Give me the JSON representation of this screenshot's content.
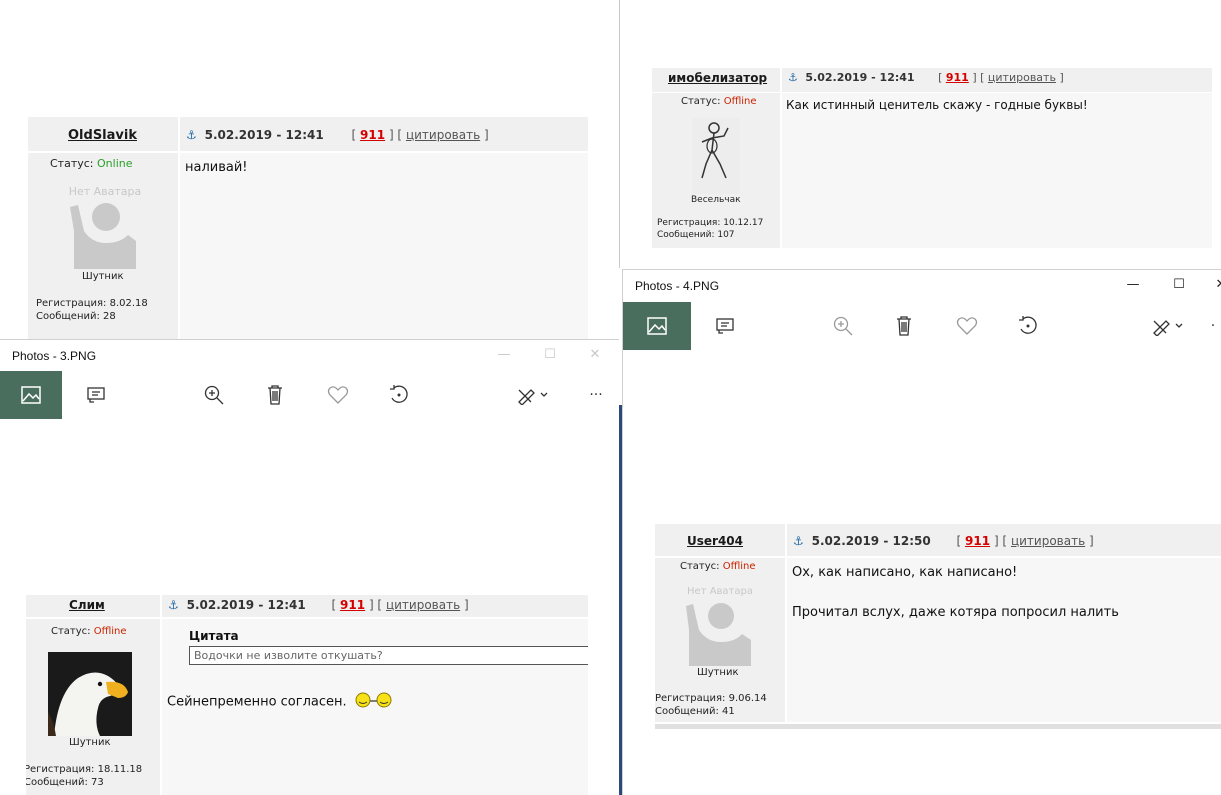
{
  "posts": {
    "oldslavik": {
      "author": "OldSlavik",
      "date": "5.02.2019 - 12:41",
      "num": "911",
      "quote_link": "цитировать",
      "status_label": "Статус:",
      "status_value": "Online",
      "avatar_text": "Нет Аватара",
      "rank": "Шутник",
      "reg": "Регистрация: 8.02.18",
      "msgs": "Сообщений: 28",
      "text": "наливай!"
    },
    "imobelizator": {
      "author": "имобелизатор",
      "date": "5.02.2019 - 12:41",
      "num": "911",
      "quote_link": "цитировать",
      "status_label": "Статус:",
      "status_value": "Offline",
      "rank": "Весельчак",
      "reg": "Регистрация: 10.12.17",
      "msgs": "Сообщений: 107",
      "text": "Как истинный ценитель скажу - годные буквы!"
    },
    "slim": {
      "author": "Слим",
      "date": "5.02.2019 - 12:41",
      "num": "911",
      "quote_link": "цитировать",
      "status_label": "Статус:",
      "status_value": "Offline",
      "rank": "Шутник",
      "reg": "Регистрация: 18.11.18",
      "msgs": "Сообщений: 73",
      "quote_title": "Цитата",
      "quote_text": "Водочки не изволите откушать?",
      "text": "Сейнепременно согласен."
    },
    "user404": {
      "author": "User404",
      "date": "5.02.2019 - 12:50",
      "num": "911",
      "quote_link": "цитировать",
      "status_label": "Статус:",
      "status_value": "Offline",
      "avatar_text": "Нет Аватара",
      "rank": "Шутник",
      "reg": "Регистрация: 9.06.14",
      "msgs": "Сообщений: 41",
      "text_line1": "Ох, как написано, как написано!",
      "text_line2": "Прочитал вслух, даже котяра попросил налить"
    }
  },
  "windows": {
    "photos3": {
      "title": "Photos - 3.PNG"
    },
    "photos4": {
      "title": "Photos - 4.PNG"
    }
  },
  "toolbar_icons": [
    "image-icon",
    "slideshow-icon",
    "zoom-in-icon",
    "delete-icon",
    "favorite-icon",
    "rotate-icon",
    "edit-icon",
    "more-icon"
  ],
  "colors": {
    "toolbar_active": "#4a6e5e",
    "online": "#2aa02a",
    "offline": "#cc2200",
    "post_number": "#d40000",
    "header_bg": "#f0f0f0"
  }
}
